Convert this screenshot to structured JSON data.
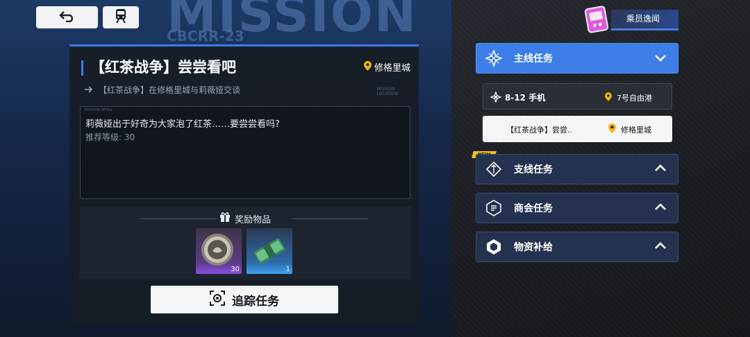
{
  "background": {
    "headline": "MISSION",
    "code": "CBCRR-23"
  },
  "top_buttons": {
    "back_icon": "undo-arrow-icon",
    "train_icon": "train-icon"
  },
  "mission": {
    "title": "【红茶战争】尝尝看吧",
    "location": "修格里城",
    "subtitle": "【红茶战争】在修格里城与莉薇娅交谈",
    "location_tag": "MISSION\nLOCATION",
    "detail_tag": "MISSION DETAIL",
    "description": "莉薇娅出于好奇为大家泡了红茶……要尝尝看吗?",
    "recommended_level": "推荐等级: 30",
    "rewards_label": "奖励物品",
    "rewards": [
      {
        "name": "coin-medal",
        "count": "30",
        "rarity_color": "#8a4fe0"
      },
      {
        "name": "cash-bundle",
        "count": "1",
        "rarity_color": "#3fa0f0"
      }
    ],
    "track_label": "追踪任务"
  },
  "crew_tab": {
    "label": "乘员逸闻"
  },
  "categories": {
    "main": {
      "label": "主线任务",
      "expanded": true
    },
    "side": {
      "label": "支线任务",
      "expanded": false,
      "badge": "NEW"
    },
    "guild": {
      "label": "商会任务",
      "expanded": false
    },
    "supply": {
      "label": "物资补给",
      "expanded": false
    }
  },
  "main_items": [
    {
      "name": "8-12 手机",
      "location": "7号自由港"
    },
    {
      "name": "【红茶战争】尝尝..",
      "location": "修格里城"
    }
  ],
  "colors": {
    "accent": "#3d7ee8",
    "pin": "#f5b400",
    "new_badge": "#f4c020"
  }
}
